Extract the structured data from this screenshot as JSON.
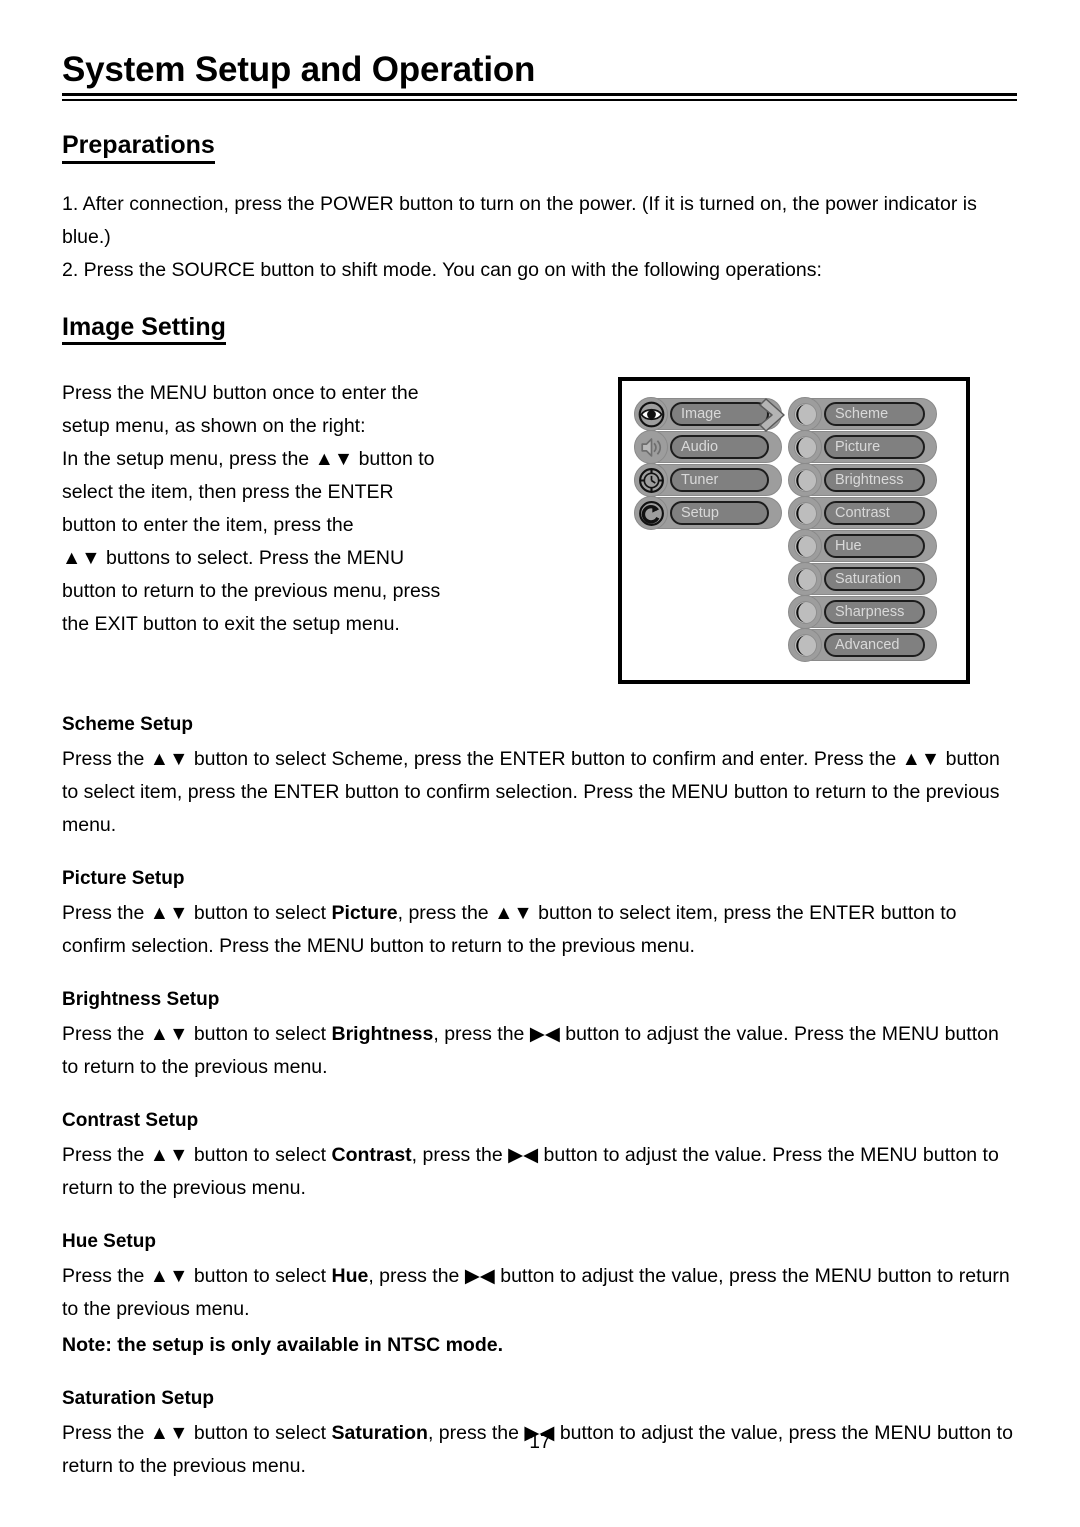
{
  "document": {
    "title": "System Setup and Operation",
    "page_number": "17"
  },
  "preparations": {
    "heading": "Preparations",
    "items": [
      "1. After connection, press the POWER button to turn on the power. (If it is turned on, the power indicator is blue.)",
      "2. Press the SOURCE button to shift mode. You can go on with the following operations:"
    ]
  },
  "image_setting": {
    "heading": "Image Setting",
    "intro": "Press the MENU button once to enter the setup menu, as shown on the right: In the setup menu, press the ▲▼ button to select the item, then press the ENTER button to enter the item, press the ▲▼ buttons to select. Press the MENU button to return to the previous menu, press the EXIT button to exit the setup menu.",
    "intro_lines": [
      "Press the MENU button once to enter the",
      "setup menu, as shown on the right:",
      "In the setup menu, press the ▲▼ button to",
      "select the item, then press the ENTER",
      "button to enter the item, press the",
      "▲▼  buttons to select. Press the MENU",
      "button to return to the previous menu, press",
      "the EXIT button to exit the setup menu."
    ]
  },
  "osd_diagram": {
    "main_menu": [
      {
        "label": "Image",
        "icon": "eye-icon"
      },
      {
        "label": "Audio",
        "icon": "speaker-icon"
      },
      {
        "label": "Tuner",
        "icon": "clock-dial-icon"
      },
      {
        "label": "Setup",
        "icon": "refresh-arrow-icon"
      }
    ],
    "sub_menu": [
      {
        "label": "Scheme",
        "icon": "crescent-moon-icon"
      },
      {
        "label": "Picture",
        "icon": "crescent-moon-icon"
      },
      {
        "label": "Brightness",
        "icon": "crescent-moon-icon"
      },
      {
        "label": "Contrast",
        "icon": "crescent-moon-icon"
      },
      {
        "label": "Hue",
        "icon": "crescent-moon-icon"
      },
      {
        "label": "Saturation",
        "icon": "crescent-moon-icon"
      },
      {
        "label": "Sharpness",
        "icon": "crescent-moon-icon"
      },
      {
        "label": "Advanced",
        "icon": "crescent-moon-icon"
      }
    ],
    "flow_arrow_icon": "chevron-right-icon",
    "colors": {
      "capsule": "#9d9d9d",
      "pill": "#808080",
      "pill_text": "#d9d9d9",
      "border": "#000000"
    }
  },
  "sections": [
    {
      "title": "Scheme Setup",
      "parts": [
        {
          "text": "Press the ",
          "bold": false
        },
        {
          "text": "▲▼",
          "bold": false
        },
        {
          "text": " button to select Scheme, press the ENTER button to confirm and enter. Press the ",
          "bold": false
        },
        {
          "text": "▲▼",
          "bold": false
        },
        {
          "text": " button to select item, press the ENTER button to confirm selection. Press the MENU button to return to the previous menu.",
          "bold": false
        }
      ]
    },
    {
      "title": "Picture Setup",
      "parts": [
        {
          "text": "Press the ",
          "bold": false
        },
        {
          "text": "▲▼",
          "bold": false
        },
        {
          "text": " button to select ",
          "bold": false
        },
        {
          "text": "Picture",
          "bold": true
        },
        {
          "text": ", press the ",
          "bold": false
        },
        {
          "text": "▲▼",
          "bold": false
        },
        {
          "text": " button to select item, press the ENTER button to confirm selection. Press the MENU button to return to the previous menu.",
          "bold": false
        }
      ]
    },
    {
      "title": "Brightness Setup",
      "parts": [
        {
          "text": "Press the ",
          "bold": false
        },
        {
          "text": "▲▼",
          "bold": false
        },
        {
          "text": " button to select ",
          "bold": false
        },
        {
          "text": "Brightness",
          "bold": true
        },
        {
          "text": ", press the ",
          "bold": false
        },
        {
          "text": "▶◀",
          "bold": false
        },
        {
          "text": " button to adjust the value. Press the MENU button to return to the previous menu.",
          "bold": false
        }
      ]
    },
    {
      "title": "Contrast Setup",
      "parts": [
        {
          "text": "Press the ",
          "bold": false
        },
        {
          "text": "▲▼",
          "bold": false
        },
        {
          "text": " button to select ",
          "bold": false
        },
        {
          "text": "Contrast",
          "bold": true
        },
        {
          "text": ", press the ",
          "bold": false
        },
        {
          "text": "▶◀",
          "bold": false
        },
        {
          "text": " button to adjust the value. Press the MENU button to return to the previous menu.",
          "bold": false
        }
      ]
    },
    {
      "title": "Hue Setup",
      "parts": [
        {
          "text": "Press the ",
          "bold": false
        },
        {
          "text": "▲▼",
          "bold": false
        },
        {
          "text": " button to select ",
          "bold": false
        },
        {
          "text": "Hue",
          "bold": true
        },
        {
          "text": ", press the ",
          "bold": false
        },
        {
          "text": "▶◀",
          "bold": false
        },
        {
          "text": " button to adjust the value, press the MENU button to return to the previous menu.",
          "bold": false
        }
      ],
      "note": "Note: the setup is only available in NTSC mode."
    },
    {
      "title": "Saturation Setup",
      "parts": [
        {
          "text": "Press the ",
          "bold": false
        },
        {
          "text": "▲▼",
          "bold": false
        },
        {
          "text": " button to select ",
          "bold": false
        },
        {
          "text": "Saturation",
          "bold": true
        },
        {
          "text": ", press the ",
          "bold": false
        },
        {
          "text": "▶◀",
          "bold": false
        },
        {
          "text": " button to adjust the value, press the MENU button to return to the previous menu.",
          "bold": false
        }
      ]
    }
  ]
}
